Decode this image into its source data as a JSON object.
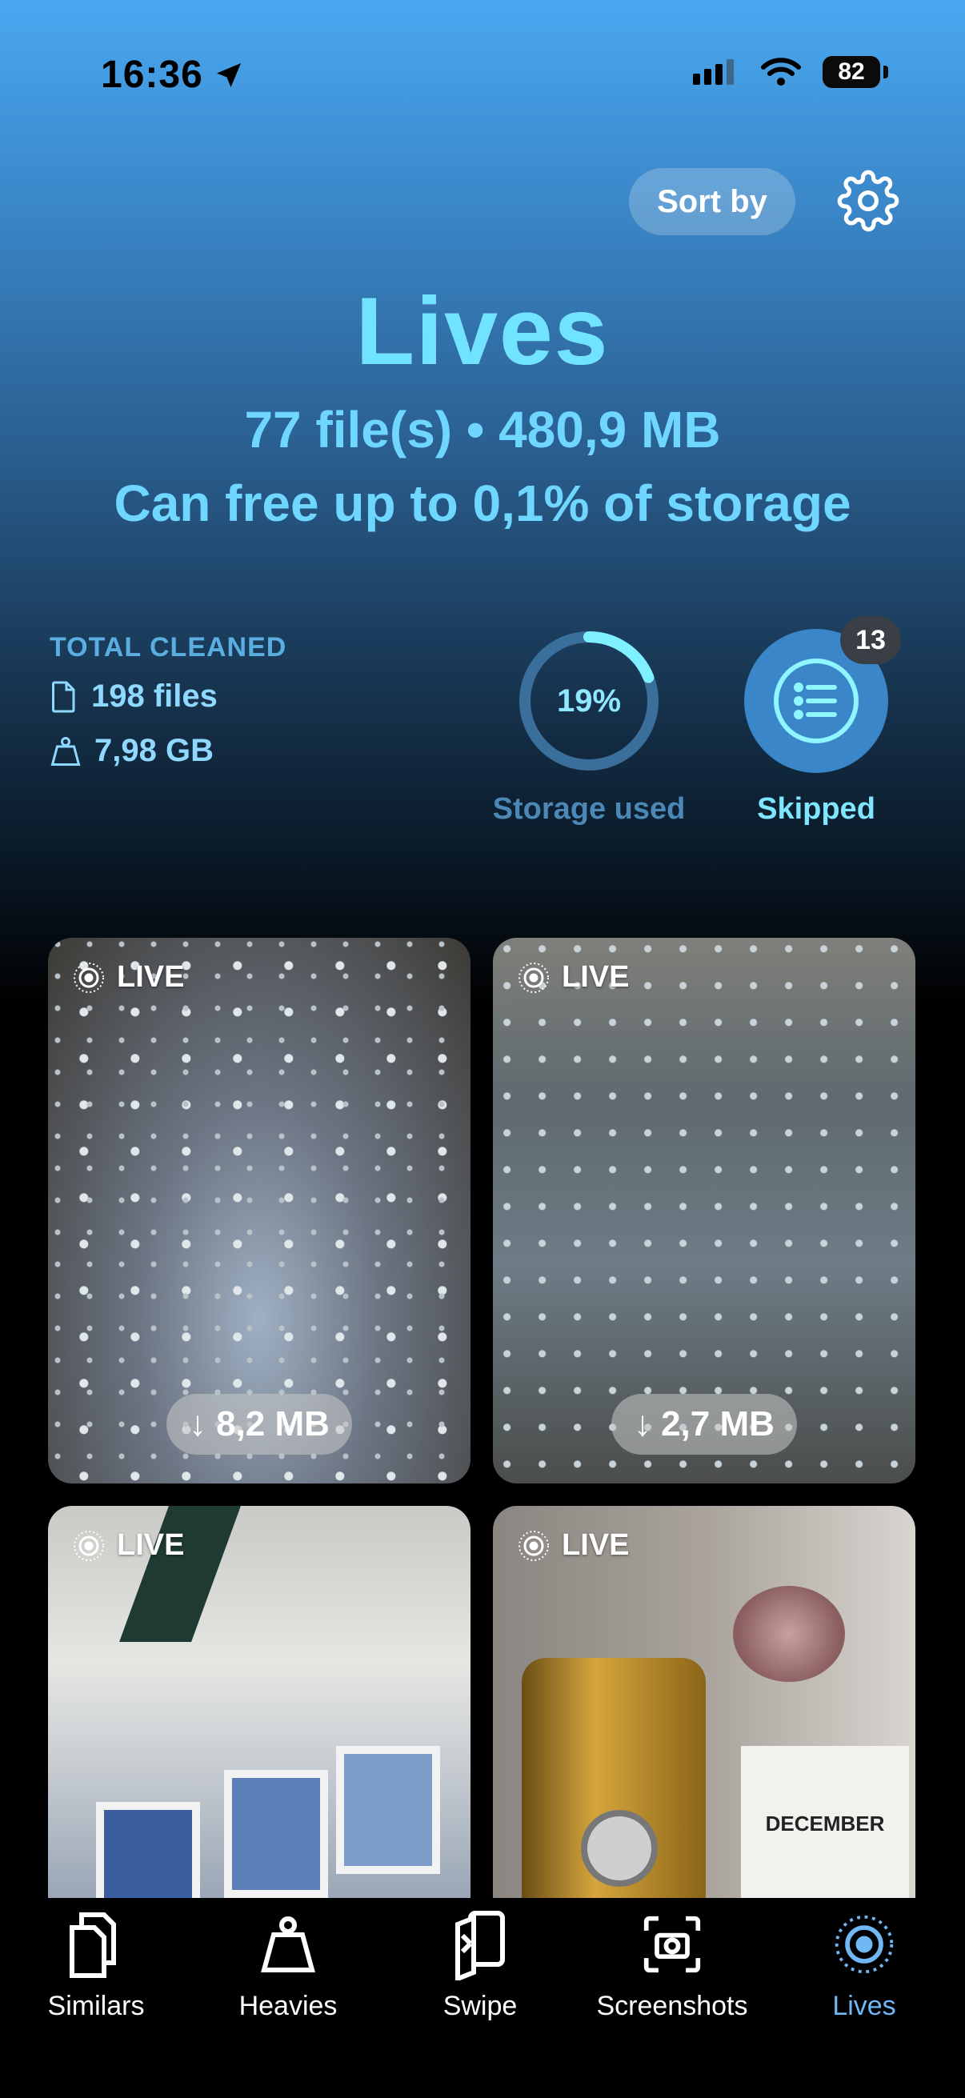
{
  "status": {
    "time": "16:36",
    "battery": "82"
  },
  "header": {
    "sort_label": "Sort by"
  },
  "title": "Lives",
  "summary": {
    "files_and_size": "77 file(s) • 480,9 MB",
    "free_up": "Can free up to 0,1% of storage"
  },
  "total_cleaned": {
    "label": "TOTAL CLEANED",
    "files": "198 files",
    "size": "7,98 GB"
  },
  "storage": {
    "percent_text": "19%",
    "percent_value": 19,
    "label": "Storage used"
  },
  "skipped": {
    "count": "13",
    "label": "Skipped"
  },
  "cards": [
    {
      "tag": "LIVE",
      "size": "8,2 MB"
    },
    {
      "tag": "LIVE",
      "size": "2,7 MB"
    },
    {
      "tag": "LIVE"
    },
    {
      "tag": "LIVE",
      "sign_text": "DECEMBER"
    }
  ],
  "tabs": [
    {
      "label": "Similars",
      "icon": "similars-icon"
    },
    {
      "label": "Heavies",
      "icon": "weight-icon"
    },
    {
      "label": "Swipe",
      "icon": "swipe-icon"
    },
    {
      "label": "Screenshots",
      "icon": "screenshot-icon"
    },
    {
      "label": "Lives",
      "icon": "live-photo-icon",
      "active": true
    }
  ],
  "colors": {
    "accent": "#6fe3ff",
    "active_tab": "#6fb8f5"
  }
}
